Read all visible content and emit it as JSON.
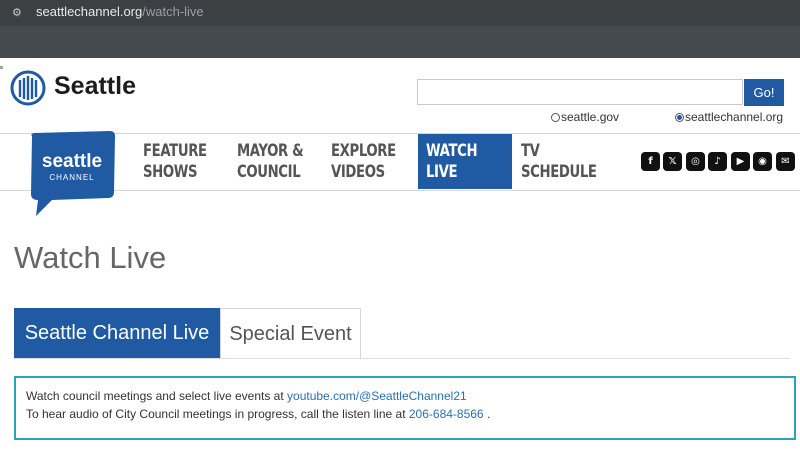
{
  "browser": {
    "url_domain": "seattlechannel.org",
    "url_path": "/watch-live"
  },
  "header": {
    "brand": "Seattle",
    "search": {
      "placeholder": "",
      "button_label": "Go!"
    },
    "scope_options": [
      {
        "label": "seattle.gov",
        "selected": false
      },
      {
        "label": "seattlechannel.org",
        "selected": true
      }
    ]
  },
  "logo": {
    "line1": "seattle",
    "line2": "CHANNEL"
  },
  "nav": {
    "items": [
      {
        "line1": "FEATURE",
        "line2": "SHOWS"
      },
      {
        "line1": "MAYOR &",
        "line2": "COUNCIL"
      },
      {
        "line1": "EXPLORE",
        "line2": "VIDEOS"
      },
      {
        "line1": "WATCH",
        "line2": "LIVE"
      },
      {
        "line1": "TV",
        "line2": "SCHEDULE"
      }
    ],
    "active_index": 3
  },
  "social": [
    "facebook-icon",
    "x-icon",
    "instagram-icon",
    "tiktok-icon",
    "youtube-icon",
    "podcast-icon",
    "email-icon"
  ],
  "page": {
    "title": "Watch Live",
    "tabs": [
      "Seattle Channel Live",
      "Special Event"
    ],
    "info": {
      "line1_text": "Watch council meetings and select live events at ",
      "line1_link": "youtube.com/@SeattleChannel21",
      "line2_text": "To hear audio of City Council meetings in progress, call the listen line at ",
      "line2_link": "206-684-8566",
      "line2_end": " ."
    }
  },
  "colors": {
    "brand_blue": "#1f5aa3",
    "info_border": "#2aa3b3",
    "link": "#2a6fb0"
  }
}
